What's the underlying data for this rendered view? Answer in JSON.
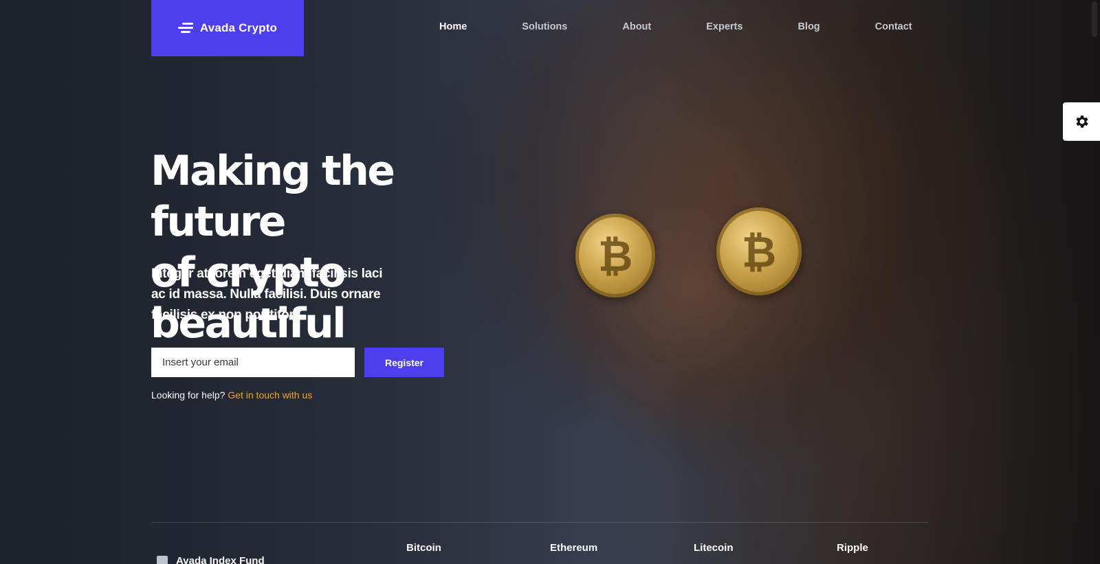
{
  "header": {
    "logo_text": "Avada Crypto",
    "brand_color": "#4d3ff0",
    "nav": [
      {
        "label": "Home",
        "active": true
      },
      {
        "label": "Solutions",
        "active": false
      },
      {
        "label": "About",
        "active": false
      },
      {
        "label": "Experts",
        "active": false
      },
      {
        "label": "Blog",
        "active": false
      },
      {
        "label": "Contact",
        "active": false
      }
    ]
  },
  "hero": {
    "headline_line1": "Making the future",
    "headline_line2": "of crypto beautiful",
    "subtext_line1": "Integer at lorem eget diam facilisis laci",
    "subtext_line2": "ac id massa. Nulla facilisi. Duis ornare",
    "subtext_line3": "facilisis ex non porttitor.",
    "email_placeholder": "Insert your email",
    "register_label": "Register",
    "help_text": "Looking for help?",
    "help_link": "Get in touch with us",
    "link_color": "#f5a524"
  },
  "ticker": {
    "fund_label": "Avada Index Fund",
    "coins": [
      "Bitcoin",
      "Ethereum",
      "Litecoin",
      "Ripple"
    ]
  },
  "icons": {
    "logo": "menu-lines-icon",
    "settings": "gear-icon",
    "coin": "bitcoin-icon"
  }
}
